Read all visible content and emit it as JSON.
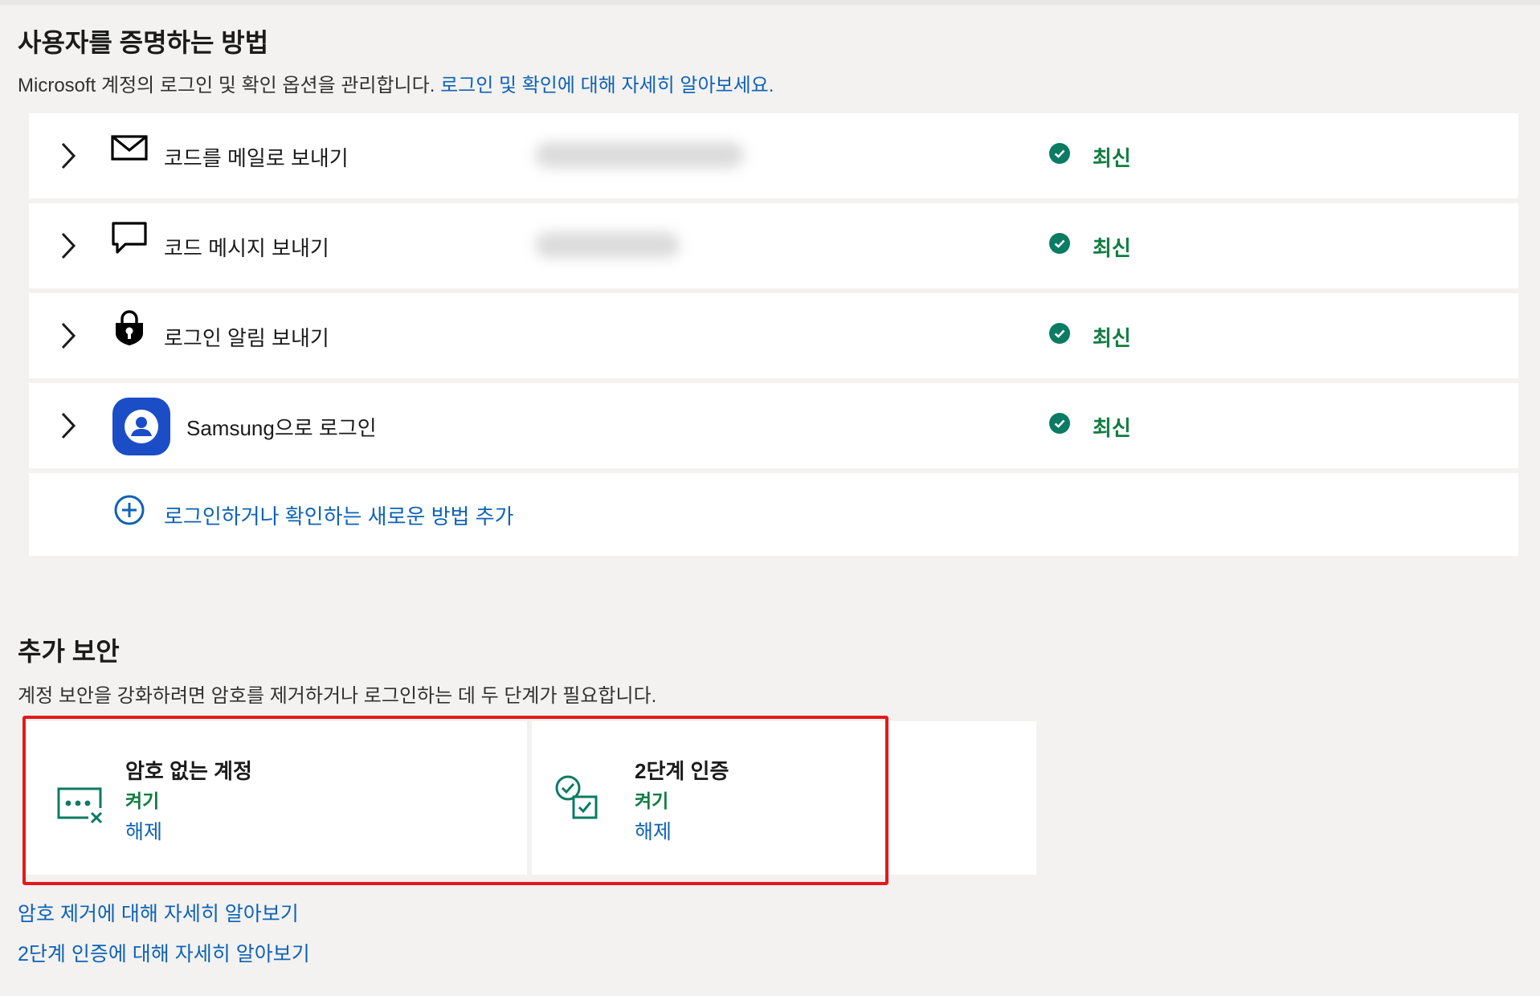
{
  "proof_section": {
    "title": "사용자를 증명하는 방법",
    "description": "Microsoft 계정의 로그인 및 확인 옵션을 관리합니다.",
    "learn_more_link": "로그인 및 확인에 대해 자세히 알아보세요."
  },
  "methods": [
    {
      "label": "코드를 메일로 보내기",
      "icon": "mail-icon",
      "status": "최신"
    },
    {
      "label": "코드 메시지 보내기",
      "icon": "message-icon",
      "status": "최신"
    },
    {
      "label": "로그인 알림 보내기",
      "icon": "lock-icon",
      "status": "최신"
    },
    {
      "label": "Samsung으로 로그인",
      "icon": "samsung-account-icon",
      "status": "최신"
    }
  ],
  "add_method": {
    "label": "로그인하거나 확인하는 새로운 방법 추가",
    "icon": "add-circle-icon"
  },
  "additional_security": {
    "title": "추가 보안",
    "description": "계정 보안을 강화하려면 암호를 제거하거나 로그인하는 데 두 단계가 필요합니다.",
    "cards": [
      {
        "title": "암호 없는 계정",
        "state": "켜기",
        "action": "해제",
        "icon": "passwordless-icon"
      },
      {
        "title": "2단계 인증",
        "state": "켜기",
        "action": "해제",
        "icon": "two-step-verification-icon"
      }
    ],
    "links": [
      "암호 제거에 대해 자세히 알아보기",
      "2단계 인증에 대해 자세히 알아보기"
    ]
  },
  "colors": {
    "accent": "#0f62b5",
    "status_green": "#107c41",
    "status_check_bg": "#0b7b63",
    "samsung_blue": "#1b4dc7",
    "highlight_red": "#e41a1a",
    "page_bg": "#f3f2f1"
  }
}
